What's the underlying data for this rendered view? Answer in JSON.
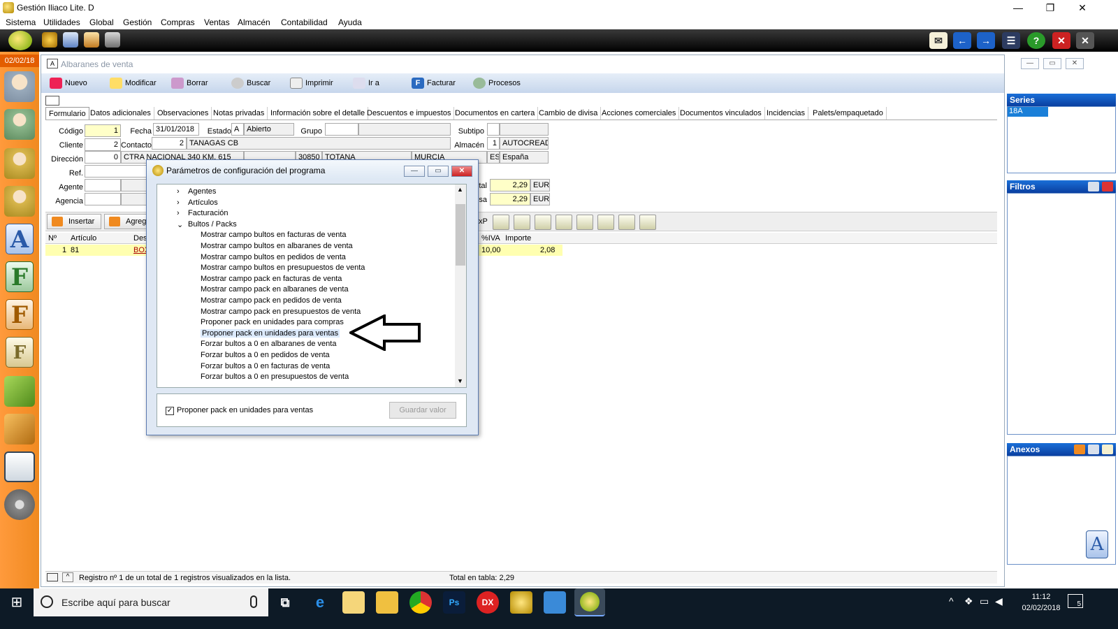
{
  "window": {
    "title": "Gestión Iliaco Lite. D",
    "minimize": "—",
    "restore": "❐",
    "close": "✕"
  },
  "menu": [
    "Sistema",
    "Utilidades",
    "Global",
    "Gestión",
    "Compras",
    "Ventas",
    "Almacén",
    "Contabilidad",
    "Ayuda"
  ],
  "date_badge": "02/02/18",
  "child": {
    "title": "Albaranes de venta",
    "toolbar": [
      "Nuevo",
      "Modificar",
      "Borrar",
      "Buscar",
      "Imprimir",
      "Ir a",
      "Facturar",
      "Procesos"
    ],
    "tabs": [
      "Formulario",
      "Datos adicionales",
      "Observaciones",
      "Notas privadas",
      "Información sobre el detalle",
      "Descuentos e impuestos",
      "Documentos en cartera",
      "Cambio de divisa",
      "Acciones comerciales",
      "Documentos vinculados",
      "Incidencias",
      "Palets/empaquetado"
    ],
    "form": {
      "codigo_label": "Código",
      "codigo": "1",
      "fecha_label": "Fecha",
      "fecha": "31/01/2018",
      "estado_label": "Estado",
      "estado_code": "A",
      "estado": "Abierto",
      "grupo_label": "Grupo",
      "subtipo_label": "Subtipo",
      "cliente_label": "Cliente",
      "cliente": "2",
      "contacto_label": "Contacto",
      "contacto": "2",
      "contacto_name": "TANAGAS CB",
      "almacen_label": "Almacén",
      "almacen": "1",
      "almacen_name": "AUTOCREAD",
      "direccion_label": "Dirección",
      "direccion_code": "0",
      "direccion": "CTRA NACIONAL 340 KM. 615",
      "cp": "30850",
      "ciudad": "TOTANA",
      "provincia": "MURCIA",
      "pais_code": "ES",
      "pais": "España",
      "ref_label": "Ref.",
      "agente_label": "Agente",
      "agencia_label": "Agencia",
      "total_label": "tal",
      "total": "2,29",
      "total_cur": "EUR",
      "base_label": "sa",
      "base": "2,29",
      "base_cur": "EUR"
    },
    "lines": {
      "insert_label": "Insertar",
      "agregar_label": "Agreg",
      "cxp_label": "xP",
      "headers": {
        "num": "Nº",
        "articulo": "Artículo",
        "desc": "Des",
        "iva": "%IVA",
        "importe": "Importe"
      },
      "rows": [
        {
          "num": "1",
          "articulo": "81",
          "desc": "BOX",
          "iva": "10,00",
          "importe": "2,08"
        }
      ]
    },
    "status": {
      "text": "Registro nº 1 de un total de 1 registros visualizados en la lista.",
      "total": "Total en tabla: 2,29"
    }
  },
  "right_panel": {
    "series_title": "Series",
    "series_value": "18A",
    "filtros_title": "Filtros",
    "anexos_title": "Anexos"
  },
  "dialog": {
    "title": "Parámetros de configuración del programa",
    "tree": [
      {
        "label": "Agentes",
        "level": 0,
        "expander": "›"
      },
      {
        "label": "Artículos",
        "level": 0,
        "expander": "›"
      },
      {
        "label": "Facturación",
        "level": 0,
        "expander": "›"
      },
      {
        "label": "Bultos / Packs",
        "level": 0,
        "expander": "⌄"
      },
      {
        "label": "Mostrar campo bultos en facturas de venta",
        "level": 1
      },
      {
        "label": "Mostrar campo bultos en albaranes de venta",
        "level": 1
      },
      {
        "label": "Mostrar campo bultos en pedidos de venta",
        "level": 1
      },
      {
        "label": "Mostrar campo bultos en presupuestos de venta",
        "level": 1
      },
      {
        "label": "Mostrar campo pack en facturas de venta",
        "level": 1
      },
      {
        "label": "Mostrar campo pack en albaranes de venta",
        "level": 1
      },
      {
        "label": "Mostrar campo pack en pedidos de venta",
        "level": 1
      },
      {
        "label": "Mostrar campo pack en presupuestos de venta",
        "level": 1
      },
      {
        "label": "Proponer pack en unidades para compras",
        "level": 1
      },
      {
        "label": "Proponer pack en unidades para ventas",
        "level": 1,
        "selected": true
      },
      {
        "label": "Forzar bultos a 0 en albaranes de venta",
        "level": 1
      },
      {
        "label": "Forzar bultos a 0 en pedidos de venta",
        "level": 1
      },
      {
        "label": "Forzar bultos a 0 en facturas de venta",
        "level": 1
      },
      {
        "label": "Forzar bultos a 0 en presupuestos de venta",
        "level": 1
      }
    ],
    "checkbox_label": "Proponer pack en unidades para ventas",
    "checkbox_checked": true,
    "save_label": "Guardar valor"
  },
  "taskbar": {
    "search_placeholder": "Escribe aquí para buscar",
    "time": "11:12",
    "date": "02/02/2018",
    "ps_label": "Ps",
    "dx_label": "DX",
    "notif_count": "5"
  }
}
